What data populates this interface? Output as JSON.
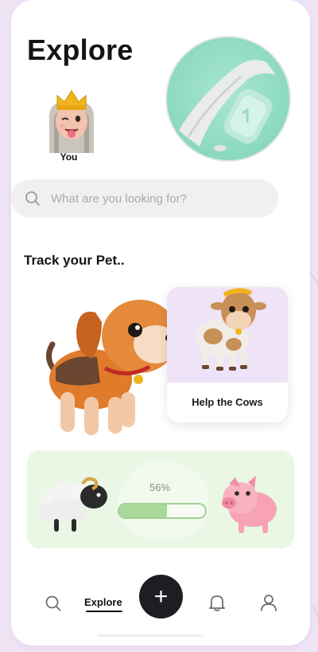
{
  "header": {
    "title": "Explore"
  },
  "profile": {
    "label": "You"
  },
  "search": {
    "placeholder": "What are you looking for?",
    "value": ""
  },
  "track": {
    "title": "Track your Pet.."
  },
  "cards": {
    "cow": {
      "label": "Help the Cows"
    },
    "progress": {
      "percent_text": "56%",
      "percent": 0.56
    }
  },
  "bottom_nav": {
    "items": [
      {
        "icon": "search-icon"
      },
      {
        "label": "Explore",
        "active": true
      },
      {
        "icon": "plus-icon",
        "label": "+"
      },
      {
        "icon": "bell-icon"
      },
      {
        "icon": "user-icon"
      }
    ]
  },
  "colors": {
    "background": "#efe4f4",
    "accent_green": "#a8d99a",
    "progress_card": "#e9f7e4",
    "cow_card_top": "#efe3f7",
    "fab": "#1e1e22"
  }
}
